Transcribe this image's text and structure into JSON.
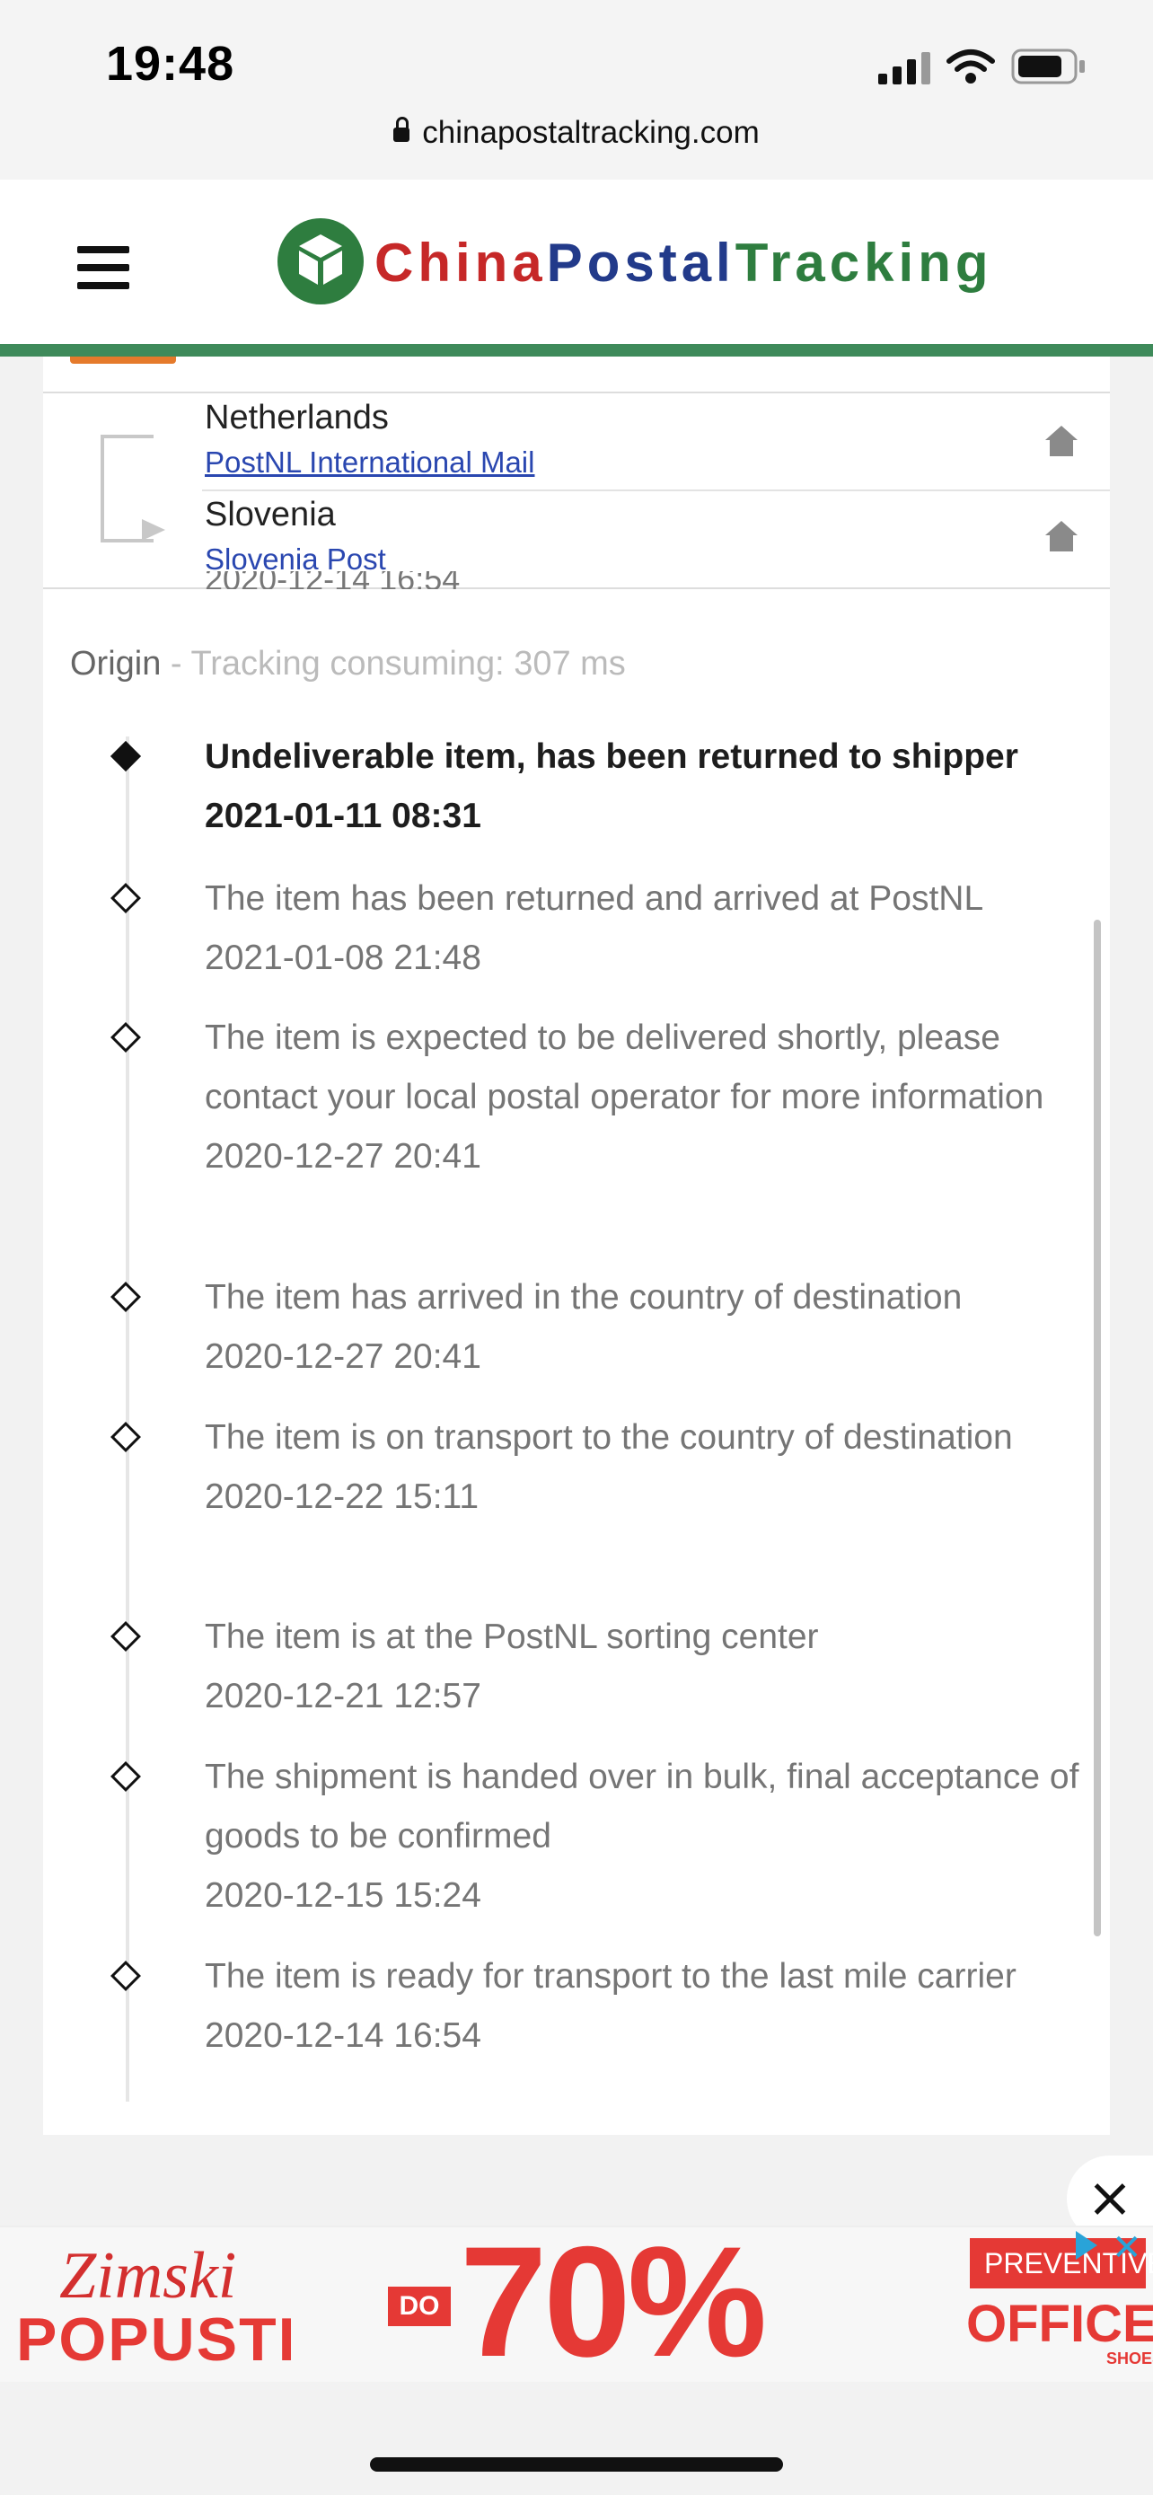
{
  "status_bar": {
    "time": "19:48",
    "url": "chinapostaltracking.com"
  },
  "header": {
    "logo": {
      "part1": "China",
      "part2": "Postal",
      "part3": "Tracking"
    }
  },
  "route": {
    "origin": {
      "country": "Netherlands",
      "carrier": "PostNL International Mail"
    },
    "destination": {
      "country": "Slovenia",
      "carrier": "Slovenia Post"
    }
  },
  "origin_line": {
    "label": "Origin",
    "timing": " - Tracking consuming: 307 ms"
  },
  "events": [
    {
      "text": "Undeliverable item, has been returned to shipper",
      "time": "2021-01-11 08:31",
      "latest": true
    },
    {
      "text": "The item has been returned and arrived at PostNL",
      "time": "2021-01-08 21:48"
    },
    {
      "text": "The item is expected to be delivered shortly, please contact your local postal operator for more information",
      "time": "2020-12-27 20:41"
    },
    {
      "text": "The item has arrived in the country of destination",
      "time": "2020-12-27 20:41"
    },
    {
      "text": "The item is on transport to the country of destination",
      "time": "2020-12-22 15:11"
    },
    {
      "text": "The item is at the PostNL sorting center",
      "time": "2020-12-21 12:57"
    },
    {
      "text": "The shipment is handed over in bulk, final acceptance of goods to be confirmed",
      "time": "2020-12-15 15:24"
    },
    {
      "text": "The item is ready for transport to the last mile carrier",
      "time": "2020-12-14 16:54"
    }
  ],
  "ad": {
    "line1": "Zimski",
    "line2": "POPUSTI",
    "do": "DO",
    "discount": "70%",
    "prevent_label": "PREVENTIVE",
    "brand": "OFFICE",
    "brand_sub": "SHOES"
  },
  "icons": {
    "menu": "hamburger-menu-icon",
    "home": "home-icon",
    "close": "close-icon",
    "lock": "lock-icon"
  },
  "colors": {
    "brand_green": "#3e8a5a",
    "china_red": "#c62828",
    "postal_blue": "#223a8a",
    "accent_orange": "#e57a2b"
  }
}
